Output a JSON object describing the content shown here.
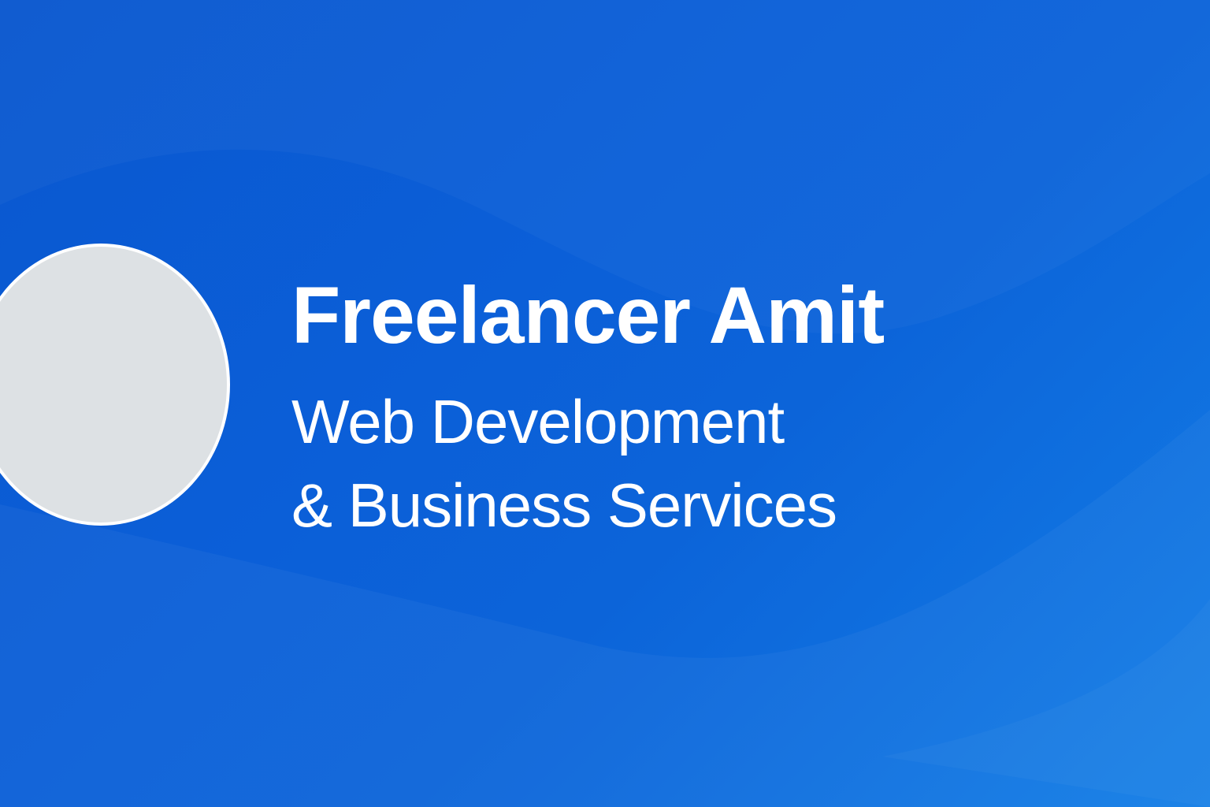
{
  "banner": {
    "title": "Freelancer Amit",
    "subtitle_line1": "Web Development",
    "subtitle_line2": "& Business Services"
  },
  "colors": {
    "background": "#0b5fd8",
    "background_light": "#137ee6",
    "avatar_fill": "#dde1e4",
    "avatar_border": "#ffffff",
    "text": "#ffffff"
  },
  "icons": {
    "avatar": "profile-photo-placeholder"
  }
}
